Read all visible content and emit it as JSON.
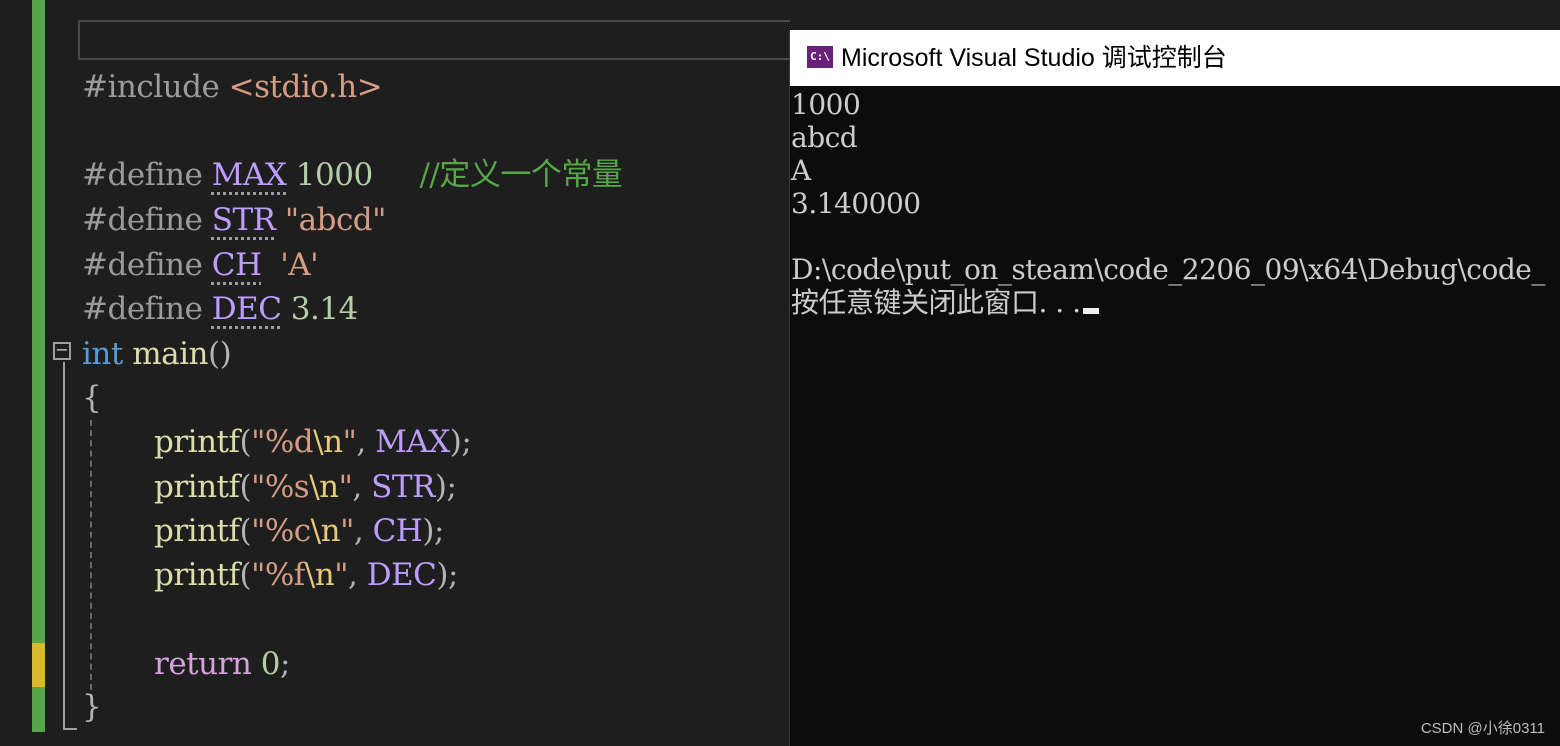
{
  "editor": {
    "lines": {
      "include": {
        "directive": "#include",
        "header": "<stdio.h>"
      },
      "define_max": {
        "directive": "#define",
        "name": "MAX",
        "value": "1000",
        "comment": "//定义一个常量"
      },
      "define_str": {
        "directive": "#define",
        "name": "STR",
        "value": "\"abcd\""
      },
      "define_ch": {
        "directive": "#define",
        "name": "CH",
        "value": "'A'"
      },
      "define_dec": {
        "directive": "#define",
        "name": "DEC",
        "value": "3.14"
      },
      "main_sig": {
        "type": "int",
        "name": "main",
        "parens": "()"
      },
      "open_brace": "{",
      "printf1": {
        "fn": "printf",
        "fmt": "\"%d",
        "esc": "\\n",
        "quote": "\"",
        "arg": "MAX"
      },
      "printf2": {
        "fn": "printf",
        "fmt": "\"%s",
        "esc": "\\n",
        "quote": "\"",
        "arg": "STR"
      },
      "printf3": {
        "fn": "printf",
        "fmt": "\"%c",
        "esc": "\\n",
        "quote": "\"",
        "arg": "CH"
      },
      "printf4": {
        "fn": "printf",
        "fmt": "\"%f",
        "esc": "\\n",
        "quote": "\"",
        "arg": "DEC"
      },
      "return_stmt": {
        "keyword": "return",
        "value": "0"
      },
      "close_brace": "}"
    },
    "collapse_symbol": "−"
  },
  "console": {
    "title": "Microsoft Visual Studio 调试控制台",
    "icon_label": "C:\\",
    "output": [
      "1000",
      "abcd",
      "A",
      "3.140000",
      "",
      "D:\\code\\put_on_steam\\code_2206_09\\x64\\Debug\\code_",
      "按任意键关闭此窗口. . ."
    ]
  },
  "watermark": "CSDN @小徐0311",
  "colors": {
    "editor_bg": "#1e1e1e",
    "console_bg": "#0c0c0c",
    "change_green": "#57a64a",
    "change_yellow": "#d7ba2e",
    "macro": "#bd9eff",
    "comment": "#57a64a",
    "string": "#d69d85",
    "keyword": "#569cd6",
    "function": "#dcdcaa",
    "control_keyword": "#d8a0df"
  }
}
